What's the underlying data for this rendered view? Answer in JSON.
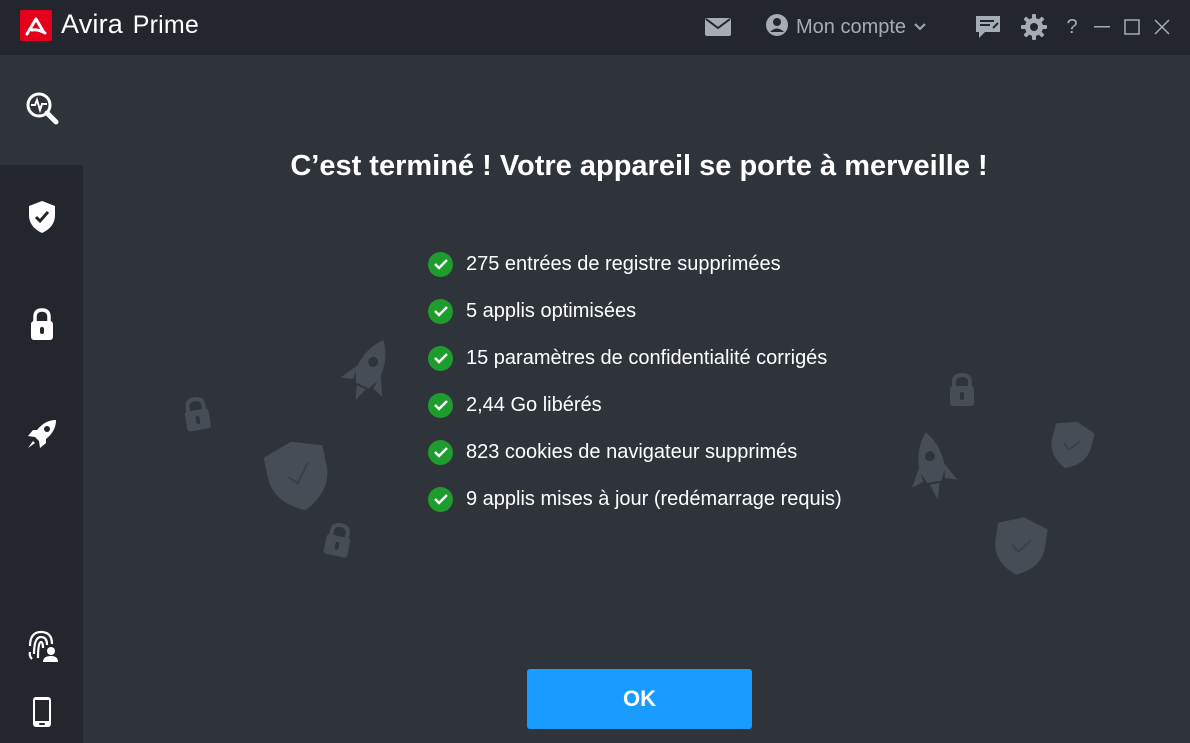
{
  "app": {
    "brand_name": "Avira",
    "brand_edition": "Prime",
    "accent_color": "#e3001b"
  },
  "titlebar": {
    "account_label": "Mon compte",
    "help_label": "?",
    "icons": [
      "mail-icon",
      "account-icon",
      "chevron-down-icon",
      "feedback-icon",
      "gear-icon",
      "minimize-icon",
      "maximize-icon",
      "close-icon"
    ]
  },
  "sidebar": {
    "items": [
      {
        "name": "scan",
        "icon": "scan-search-icon",
        "active": true
      },
      {
        "name": "security",
        "icon": "shield-check-icon",
        "active": false
      },
      {
        "name": "privacy",
        "icon": "lock-icon",
        "active": false
      },
      {
        "name": "performance",
        "icon": "rocket-icon",
        "active": false
      },
      {
        "name": "identity",
        "icon": "fingerprint-user-icon",
        "active": false
      },
      {
        "name": "mobile",
        "icon": "smartphone-icon",
        "active": false
      }
    ]
  },
  "main": {
    "headline": "C’est terminé ! Votre appareil se porte à merveille !",
    "results": [
      "275 entrées de registre supprimées",
      "5 applis optimisées",
      "15 paramètres de confidentialité corrigés",
      "2,44 Go libérés",
      "823 cookies de navigateur supprimés",
      "9 applis mises à jour (redémarrage requis)"
    ],
    "ok_label": "OK",
    "success_color": "#1e9c2e",
    "button_color": "#1a9cff"
  }
}
